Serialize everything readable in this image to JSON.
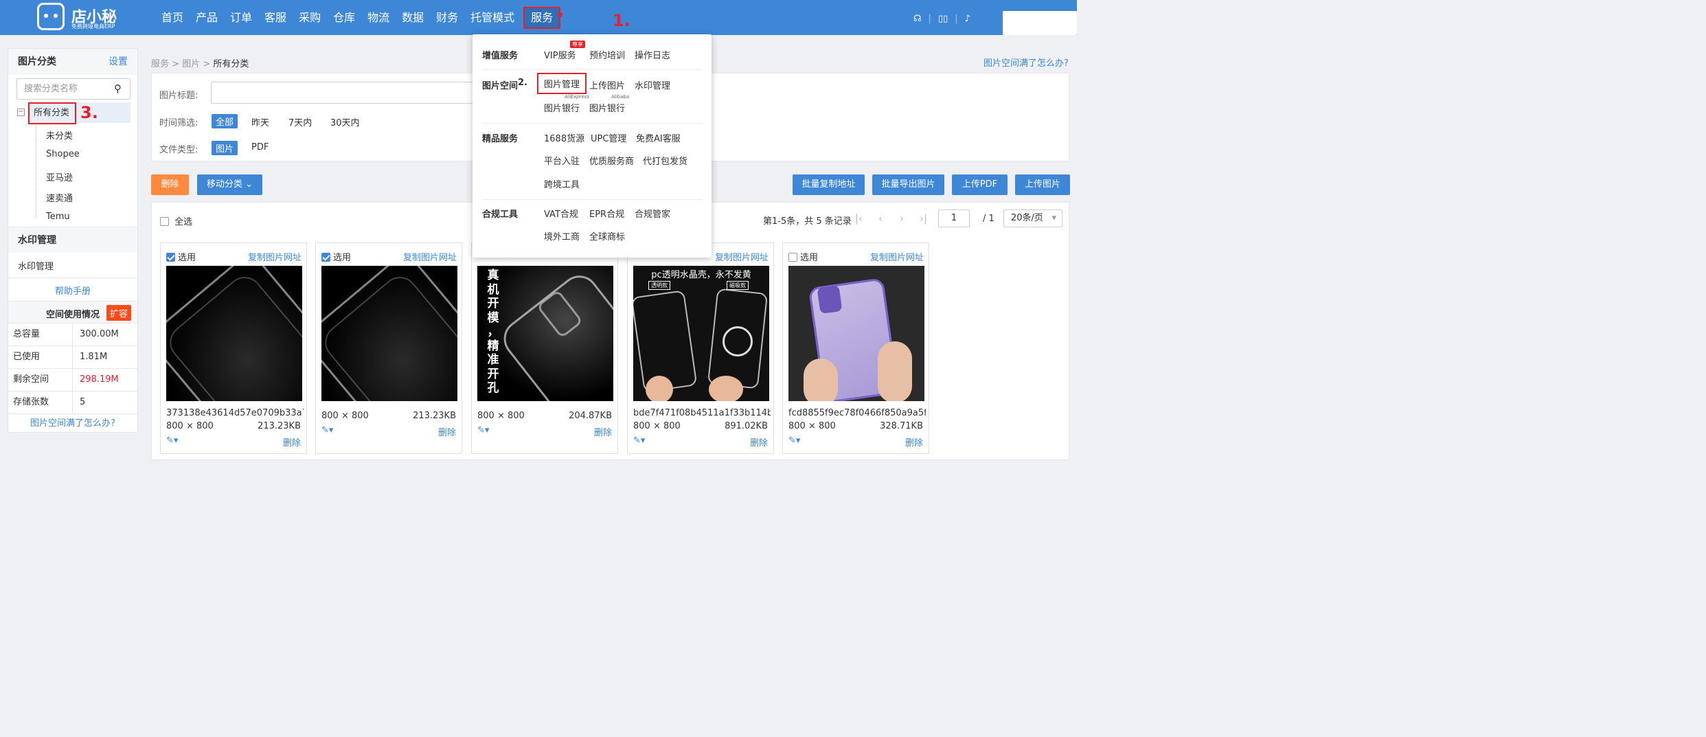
{
  "logo": {
    "name": "店小秘",
    "tagline": "免费跨境电商ERP"
  },
  "nav": {
    "items": [
      "首页",
      "产品",
      "订单",
      "客服",
      "采购",
      "仓库",
      "物流",
      "数据",
      "财务",
      "托管模式"
    ],
    "active": "服务",
    "step1": "1.",
    "badge_color": "#e8202a"
  },
  "left": {
    "category_title": "图片分类",
    "settings": "设置",
    "search_placeholder": "搜索分类名称",
    "tree": {
      "root": "所有分类",
      "step3": "3.",
      "children": [
        "未分类",
        "Shopee",
        "亚马逊",
        "速卖通",
        "Temu"
      ]
    },
    "watermark_title": "水印管理",
    "watermark_item": "水印管理",
    "help": "帮助手册",
    "usage_title": "空间使用情况",
    "expand": "扩容",
    "stats": [
      {
        "k": "总容量",
        "v": "300.00M"
      },
      {
        "k": "已使用",
        "v": "1.81M"
      },
      {
        "k": "剩余空间",
        "v": "298.19M"
      },
      {
        "k": "存储张数",
        "v": "5"
      }
    ],
    "full_link": "图片空间满了怎么办?"
  },
  "breadcrumb": {
    "a": "服务",
    "b": "图片",
    "c": "所有分类",
    "sep": ">"
  },
  "top_link": "图片空间满了怎么办?",
  "filter": {
    "title_label": "图片标题:",
    "time_label": "时间筛选:",
    "time_opts": [
      "全部",
      "昨天",
      "7天内",
      "30天内"
    ],
    "type_label": "文件类型:",
    "type_opts": [
      "图片",
      "PDF"
    ]
  },
  "actions": {
    "delete": "删除",
    "move": "移动分类",
    "copy_addr": "批量复制地址",
    "export": "批量导出图片",
    "upload_pdf": "上传PDF",
    "upload_img": "上传图片"
  },
  "list": {
    "select_all": "全选",
    "summary": "第1-5条，共 5 条记录",
    "page": "1",
    "total_pages": "/ 1",
    "page_size": "20条/页"
  },
  "cards": [
    {
      "select": "选用",
      "copy": "复制图片网址",
      "name": "373138e43614d57e0709b33a7...",
      "dim": "800 × 800",
      "size": "213.23KB",
      "del": "删除",
      "checked": true
    },
    {
      "select": "选用",
      "copy": "复制图片网址",
      "name": "",
      "dim": "800 × 800",
      "size": "213.23KB",
      "del": "删除",
      "checked": true
    },
    {
      "select": "选用",
      "copy": "复制图片网址",
      "name": "",
      "dim": "800 × 800",
      "size": "204.87KB",
      "del": "删除",
      "checked": false,
      "text": [
        "真",
        "机",
        "开",
        "模",
        "，",
        "精",
        "准",
        "开",
        "孔"
      ]
    },
    {
      "select": "选用",
      "copy": "复制图片网址",
      "name": "bde7f471f08b4511a1f33b114bf...",
      "dim": "800 × 800",
      "size": "891.02KB",
      "del": "删除",
      "checked": false,
      "text_top": "pc透明水晶壳，永不发黄",
      "l1": "透明款",
      "l2": "磁吸款"
    },
    {
      "select": "选用",
      "copy": "复制图片网址",
      "name": "fcd8855f9ec78f0466f850a9a5f...",
      "dim": "800 × 800",
      "size": "328.71KB",
      "del": "删除",
      "checked": false
    }
  ],
  "dropdown": {
    "vas_title": "增值服务",
    "vip": "VIP服务",
    "vip_badge": "尊享",
    "training": "预约培训",
    "log": "操作日志",
    "space_title": "图片空间",
    "step2": "2.",
    "manage": "图片管理",
    "upload": "上传图片",
    "watermark": "水印管理",
    "bank_ae": "图片银行",
    "ae_tag": "AliExpress",
    "bank_ali": "图片银行",
    "ali_tag": "Alibaba",
    "premium_title": "精品服务",
    "src1688": "1688货源",
    "upc": "UPC管理",
    "ai": "免费AI客服",
    "platform": "平台入驻",
    "provider": "优质服务商",
    "pack": "代打包发货",
    "cross": "跨境工具",
    "comp_title": "合规工具",
    "vat": "VAT合规",
    "epr": "EPR合规",
    "steward": "合规管家",
    "overseas": "境外工商",
    "tm": "全球商标"
  }
}
